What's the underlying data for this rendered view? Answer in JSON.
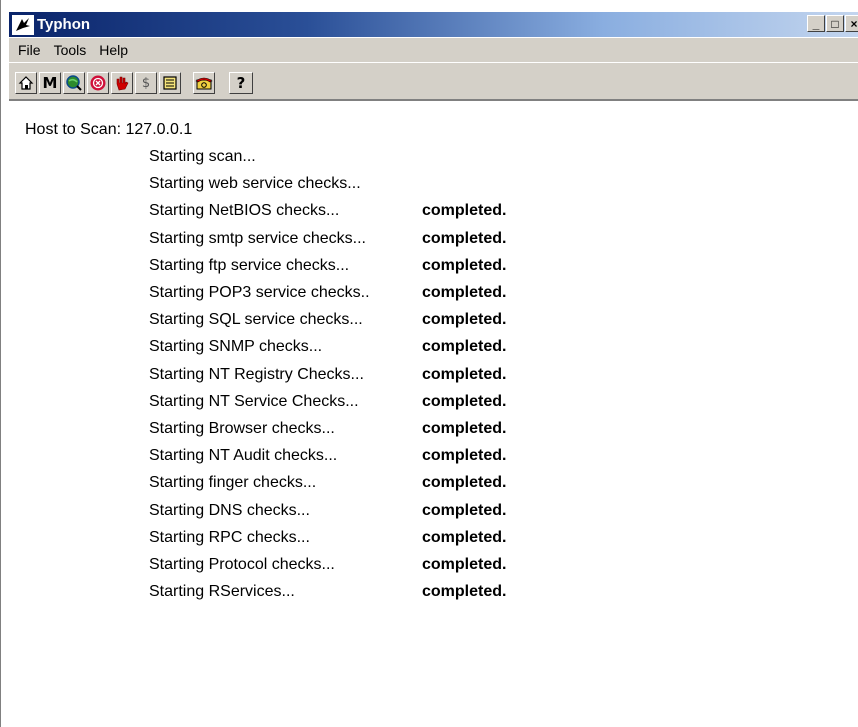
{
  "window": {
    "title": "Typhon",
    "controls": {
      "minimize": "_",
      "maximize": "□",
      "close": "×"
    }
  },
  "menu": [
    "File",
    "Tools",
    "Help"
  ],
  "toolbar": {
    "buttons": [
      {
        "icon": "home-icon"
      },
      {
        "icon": "m-letter-icon",
        "label": "M"
      },
      {
        "icon": "globe-search-icon"
      },
      {
        "icon": "stop-circle-icon"
      },
      {
        "icon": "hand-stop-icon"
      },
      {
        "icon": "dollar-icon",
        "label": "$"
      },
      {
        "icon": "document-list-icon"
      },
      {
        "icon": "phone-icon"
      },
      {
        "icon": "help-icon",
        "label": "?"
      }
    ]
  },
  "scan": {
    "host_label": "Host to Scan:",
    "host_value": "127.0.0.1",
    "log": [
      {
        "text": "Starting scan...",
        "status": ""
      },
      {
        "text": "Starting web service checks...",
        "status": ""
      },
      {
        "text": "Starting NetBIOS checks...",
        "status": "completed."
      },
      {
        "text": "Starting smtp service checks...",
        "status": "completed."
      },
      {
        "text": "Starting ftp service checks...",
        "status": "completed."
      },
      {
        "text": "Starting POP3 service checks..",
        "status": "completed."
      },
      {
        "text": "Starting SQL service checks...",
        "status": "completed."
      },
      {
        "text": "Starting SNMP checks...",
        "status": "completed."
      },
      {
        "text": "Starting NT Registry Checks...",
        "status": "completed."
      },
      {
        "text": "Starting NT Service Checks...",
        "status": "completed."
      },
      {
        "text": "Starting Browser checks...",
        "status": "completed."
      },
      {
        "text": "Starting NT Audit checks...",
        "status": "completed."
      },
      {
        "text": "Starting finger checks...",
        "status": "completed."
      },
      {
        "text": "Starting DNS checks...",
        "status": "completed."
      },
      {
        "text": "Starting RPC checks...",
        "status": "completed."
      },
      {
        "text": "Starting Protocol checks...",
        "status": "completed."
      },
      {
        "text": "Starting RServices...",
        "status": "completed."
      }
    ]
  }
}
